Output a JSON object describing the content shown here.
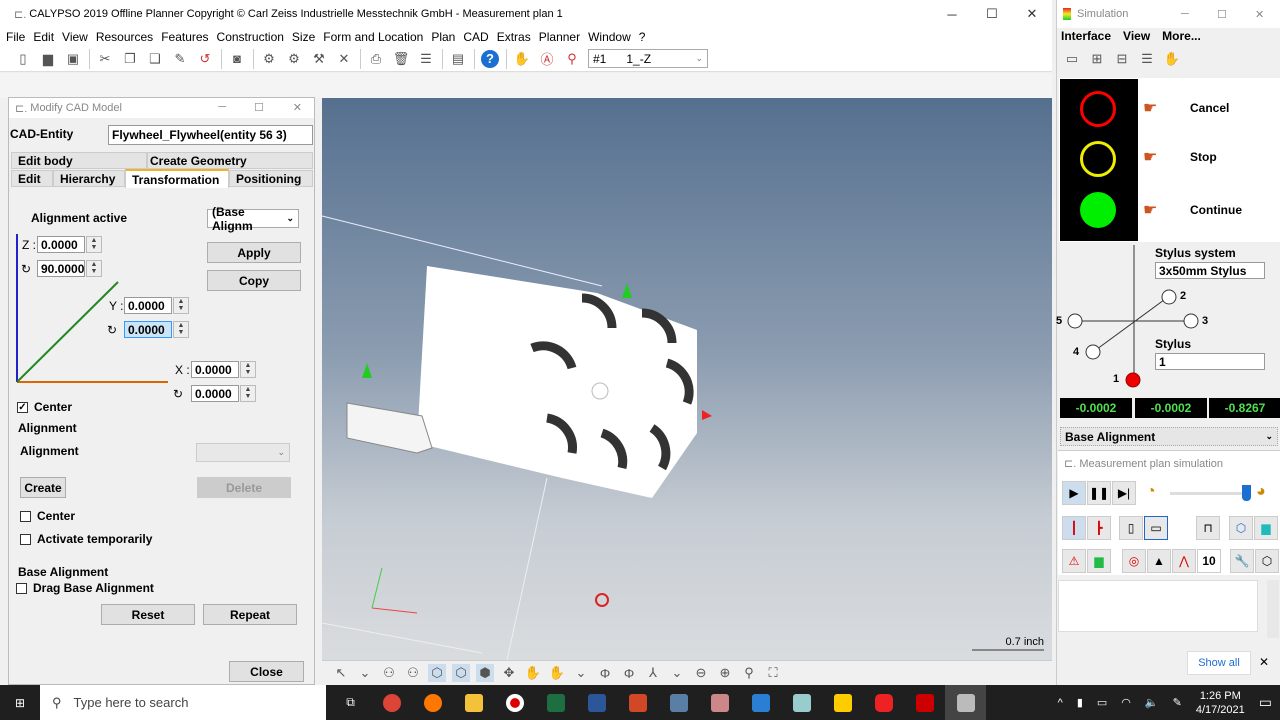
{
  "app": {
    "title": "CALYPSO 2019 Offline Planner Copyright © Carl Zeiss Industrielle Messtechnik GmbH - Measurement plan 1",
    "menu": [
      "File",
      "Edit",
      "View",
      "Resources",
      "Features",
      "Construction",
      "Size",
      "Form and Location",
      "Plan",
      "CAD",
      "Extras",
      "Planner",
      "Window",
      "?"
    ],
    "plan_combo": {
      "num": "#1",
      "value": "1_-Z"
    }
  },
  "dialog": {
    "title": "Modify CAD Model",
    "entity_label": "CAD-Entity",
    "entity_value": "Flywheel_Flywheel(entity 56 3)",
    "tabs_top": [
      "Edit body",
      "Create Geometry"
    ],
    "tabs": [
      "Edit",
      "Hierarchy",
      "Transformation",
      "Positioning"
    ],
    "alignment_active": "Alignment active",
    "alignment_combo": "(Base Alignm",
    "apply": "Apply",
    "copy": "Copy",
    "z_label": "Z :",
    "z": "0.0000",
    "z_rot": "90.0000",
    "y_label": "Y :",
    "y": "0.0000",
    "y_rot": "0.0000",
    "x_label": "X :",
    "x": "0.0000",
    "x_rot": "0.0000",
    "center": "Center",
    "alignment_group": "Alignment",
    "alignment_label": "Alignment",
    "create": "Create",
    "delete": "Delete",
    "center2": "Center",
    "activate_temp": "Activate temporarily",
    "base_group": "Base Alignment",
    "drag_base": "Drag Base Alignment",
    "reset": "Reset",
    "repeat": "Repeat",
    "close": "Close"
  },
  "viewport": {
    "scale": "0.7 inch"
  },
  "simulation": {
    "title": "Simulation",
    "menu": [
      "Interface",
      "View",
      "More..."
    ],
    "cancel": "Cancel",
    "stop": "Stop",
    "continue": "Continue",
    "stylus_system_label": "Stylus system",
    "stylus_system": "3x50mm Stylus",
    "stylus_label": "Stylus",
    "stylus": "1",
    "styli": [
      "1",
      "2",
      "3",
      "4",
      "5"
    ],
    "coords": [
      "-0.0002",
      "-0.0002",
      "-0.8267"
    ],
    "alignment": "Base Alignment",
    "plan_sim_title": "Measurement plan simulation",
    "speed_value": "10",
    "show_all": "Show all"
  },
  "taskbar": {
    "search": "Type here to search",
    "time": "1:26 PM",
    "date": "4/17/2021"
  },
  "colors": {
    "red": "#ff0000",
    "yellow": "#ffff00",
    "green": "#00ee00"
  }
}
